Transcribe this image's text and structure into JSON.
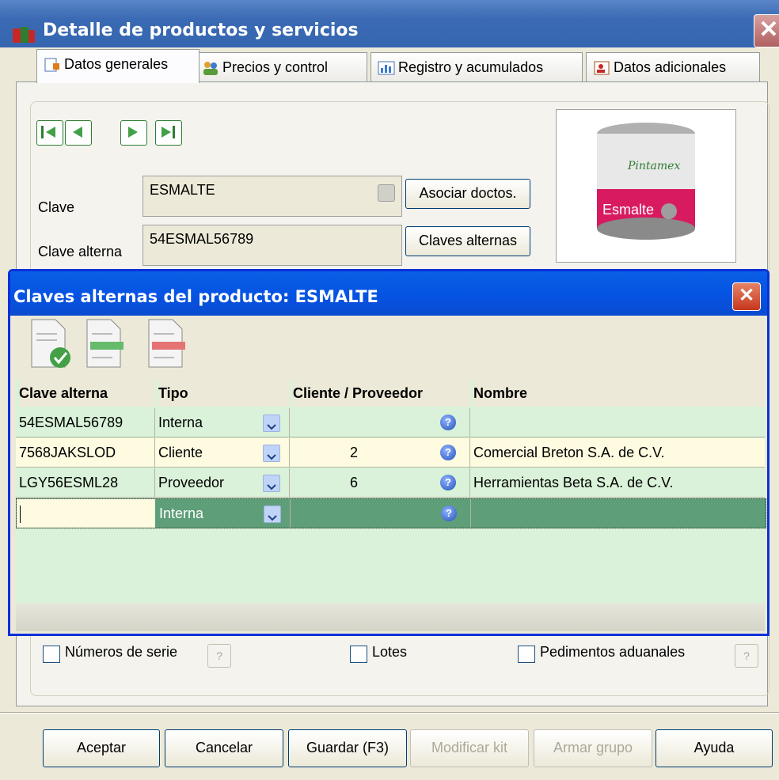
{
  "window": {
    "title": "Detalle de productos y servicios",
    "close_glyph": "✕"
  },
  "tabs": [
    {
      "label": "Datos generales",
      "icon": "form-icon"
    },
    {
      "label": "Precios y control",
      "icon": "users-icon"
    },
    {
      "label": "Registro y acumulados",
      "icon": "chart-icon"
    },
    {
      "label": "Datos adicionales",
      "icon": "contact-icon"
    }
  ],
  "form": {
    "clave_label": "Clave",
    "clave_value": "ESMALTE",
    "alterna_label": "Clave alterna",
    "alterna_value": "54ESMAL56789",
    "asociar_button": "Asociar doctos.",
    "claves_button": "Claves alternas"
  },
  "product_image": {
    "brand": "Pintamex",
    "product": "Esmalte"
  },
  "dialog": {
    "title": "Claves alternas del producto: ESMALTE",
    "columns": [
      "Clave alterna",
      "Tipo",
      "Cliente / Proveedor",
      "Nombre"
    ],
    "rows": [
      {
        "clave": "54ESMAL56789",
        "tipo": "Interna",
        "cliente": "",
        "nombre": ""
      },
      {
        "clave": "7568JAKSLOD",
        "tipo": "Cliente",
        "cliente": "2",
        "nombre": "Comercial Breton S.A. de C.V."
      },
      {
        "clave": "LGY56ESML28",
        "tipo": "Proveedor",
        "cliente": "6",
        "nombre": "Herramientas Beta S.A. de C.V."
      },
      {
        "clave": "",
        "tipo": "Interna",
        "cliente": "",
        "nombre": ""
      }
    ]
  },
  "checkboxes": {
    "series": "Números de serie",
    "lotes": "Lotes",
    "pedimentos": "Pedimentos aduanales"
  },
  "buttons": {
    "aceptar": "Aceptar",
    "cancelar": "Cancelar",
    "guardar": "Guardar (F3)",
    "modificar": "Modificar kit",
    "armar": "Armar grupo",
    "ayuda": "Ayuda"
  },
  "colors": {
    "title_blue": "#0554e4",
    "grid_green": "#d9f2d9",
    "selected_row": "#5e9e78",
    "row_yellow": "#fffbe0"
  }
}
